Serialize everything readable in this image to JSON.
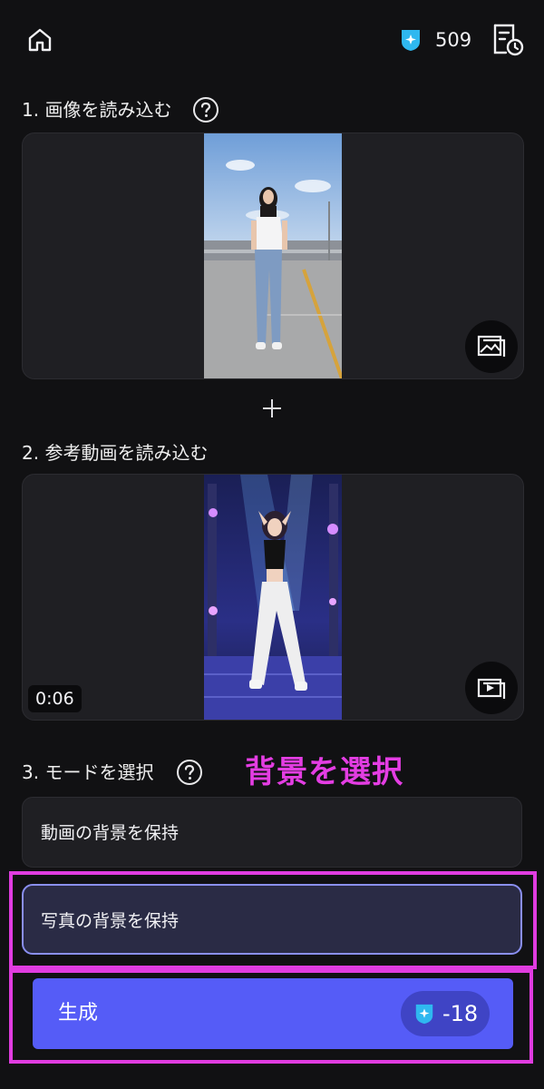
{
  "header": {
    "credit_count": "509"
  },
  "sections": {
    "image_title": "1. 画像を読み込む",
    "video_title": "2. 参考動画を読み込む",
    "mode_title": "3. モードを選択"
  },
  "video": {
    "duration": "0:06"
  },
  "annotation": {
    "label": "背景を選択"
  },
  "modes": {
    "keep_video_bg": "動画の背景を保持",
    "keep_photo_bg": "写真の背景を保持",
    "selected": "keep_photo_bg"
  },
  "generate": {
    "label": "生成",
    "cost": "-18"
  },
  "colors": {
    "accent": "#555cf7",
    "annotation": "#e03ce0",
    "credit_icon": "#2fb8f0"
  },
  "icons": {
    "home": "home-icon",
    "credit": "credit-badge-icon",
    "history": "history-document-icon",
    "help": "question-circle-icon",
    "replace_image": "replace-image-icon",
    "replace_video": "replace-video-icon",
    "plus": "plus-icon"
  }
}
